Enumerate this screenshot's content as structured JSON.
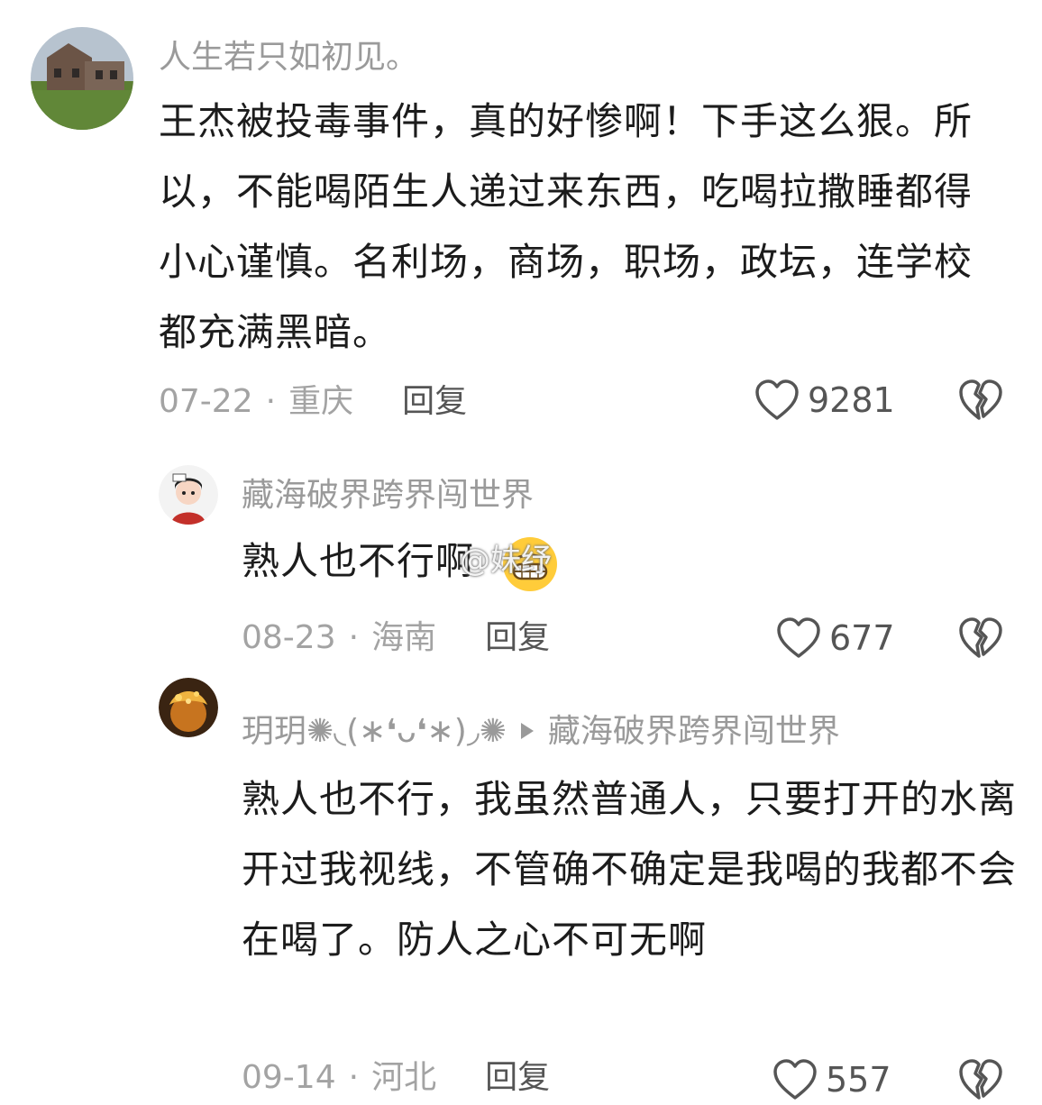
{
  "comments": [
    {
      "username": "人生若只如初见。",
      "content": "王杰被投毒事件，真的好惨啊！下手这么狠。所以，不能喝陌生人递过来东西，吃喝拉撒睡都得小心谨慎。名利场，商场，职场，政坛，连学校都充满黑暗。",
      "date": "07-22",
      "location": "重庆",
      "reply_label": "回复",
      "likes": "9281"
    },
    {
      "username": "藏海破界跨界闯世界",
      "content": "熟人也不行啊",
      "date": "08-23",
      "location": "海南",
      "reply_label": "回复",
      "likes": "677"
    },
    {
      "username": "玥玥✺◟(∗❛ᴗ❛∗)◞✺",
      "reply_to": "藏海破界跨界闯世界",
      "content": "熟人也不行，我虽然普通人，只要打开的水离开过我视线，不管确不确定是我喝的我都不会在喝了。防人之心不可无啊",
      "date": "09-14",
      "location": "河北",
      "reply_label": "回复",
      "likes": "557"
    }
  ],
  "separator": "·",
  "watermark": "@妹纾",
  "icons": {
    "like": "heart-outline-icon",
    "dislike": "broken-heart-icon",
    "reply_arrow": "triangle-right-icon",
    "emoji": "grinning-face-emoji"
  },
  "colors": {
    "text": "#1c1c1c",
    "muted": "#9a9a9a",
    "icon": "#555555"
  }
}
